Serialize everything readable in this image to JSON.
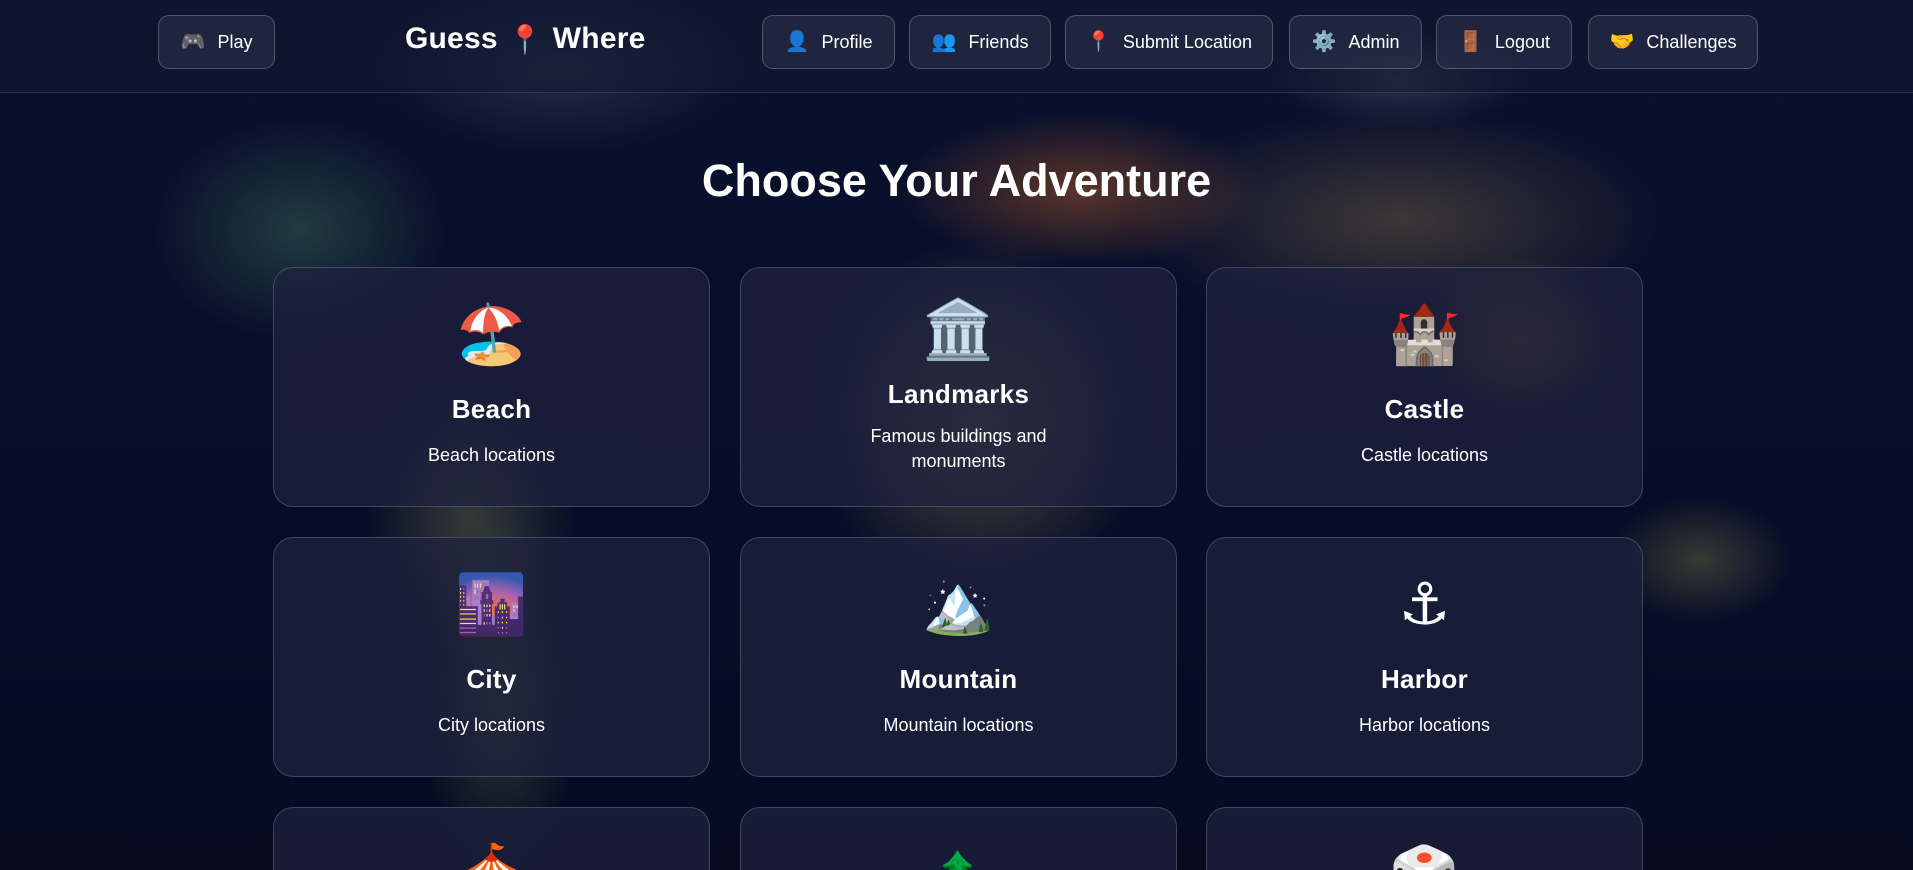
{
  "header": {
    "brand": {
      "text_left": "Guess",
      "pin_emoji": "📍",
      "text_right": "Where"
    },
    "nav": [
      {
        "id": "play",
        "icon": "🎮",
        "icon_name": "gamepad-icon",
        "label": "Play"
      },
      {
        "id": "profile",
        "icon": "👤",
        "icon_name": "user-icon",
        "label": "Profile"
      },
      {
        "id": "friends",
        "icon": "👥",
        "icon_name": "users-icon",
        "label": "Friends"
      },
      {
        "id": "submit",
        "icon": "📍",
        "icon_name": "pin-icon",
        "label": "Submit Location"
      },
      {
        "id": "admin",
        "icon": "⚙️",
        "icon_name": "gear-icon",
        "label": "Admin"
      },
      {
        "id": "logout",
        "icon": "🚪",
        "icon_name": "door-icon",
        "label": "Logout"
      },
      {
        "id": "challenges",
        "icon": "🤝",
        "icon_name": "handshake-icon",
        "label": "Challenges"
      }
    ]
  },
  "main": {
    "title": "Choose Your Adventure",
    "categories": [
      {
        "icon": "🏖️",
        "icon_name": "beach-umbrella-icon",
        "title": "Beach",
        "description": "Beach locations"
      },
      {
        "icon": "🏛️",
        "icon_name": "classical-building-icon",
        "title": "Landmarks",
        "description": "Famous buildings and monuments"
      },
      {
        "icon": "🏰",
        "icon_name": "castle-icon",
        "title": "Castle",
        "description": "Castle locations"
      },
      {
        "icon": "🌆",
        "icon_name": "city-dusk-icon",
        "title": "City",
        "description": "City locations"
      },
      {
        "icon": "🏔️",
        "icon_name": "mountain-icon",
        "title": "Mountain",
        "description": "Mountain locations"
      },
      {
        "icon": "⚓",
        "icon_name": "anchor-icon",
        "title": "Harbor",
        "description": "Harbor locations"
      },
      {
        "icon": "🎪",
        "icon_name": "circus-tent-icon",
        "title": "",
        "description": ""
      },
      {
        "icon": "🌲",
        "icon_name": "tree-icon",
        "title": "",
        "description": ""
      },
      {
        "icon": "🎲",
        "icon_name": "dice-icon",
        "title": "",
        "description": ""
      }
    ]
  },
  "colors": {
    "background": "#050a1c",
    "card": "#1e223e",
    "text": "#ffffff"
  }
}
